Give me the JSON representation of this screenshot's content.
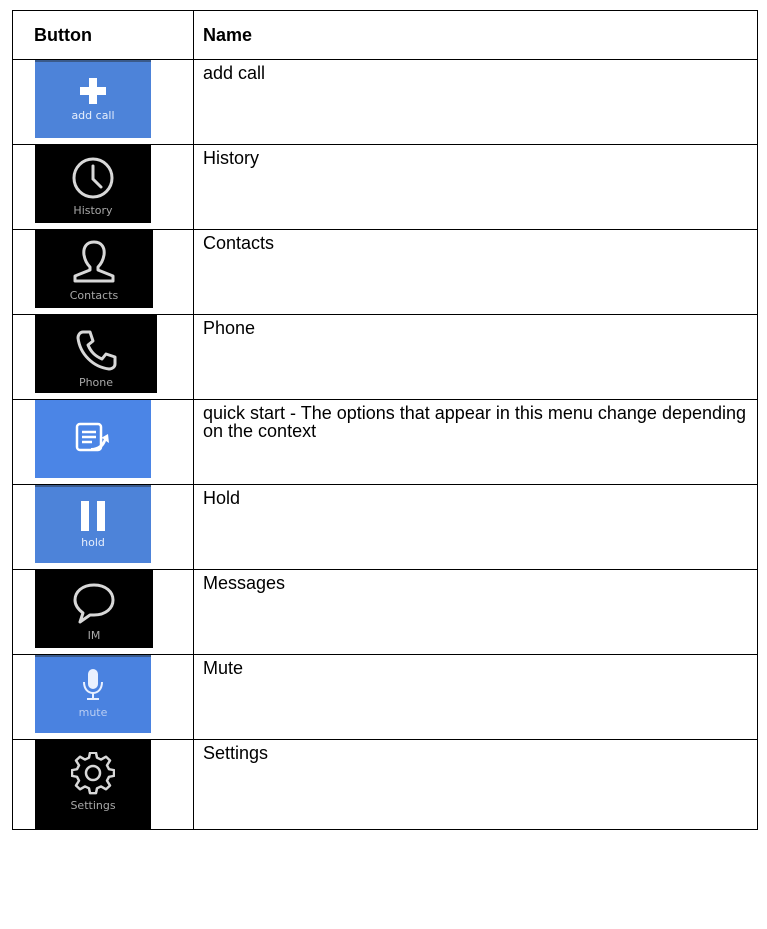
{
  "table": {
    "headers": {
      "button": "Button",
      "name": "Name"
    },
    "rows": [
      {
        "icon": "add-call-icon",
        "caption": "add call",
        "name": "add call",
        "style": "blue"
      },
      {
        "icon": "clock-icon",
        "caption": "History",
        "name": "History",
        "style": "dark"
      },
      {
        "icon": "contact-person-icon",
        "caption": "Contacts",
        "name": "Contacts",
        "style": "dark"
      },
      {
        "icon": "phone-handset-icon",
        "caption": "Phone",
        "name": "Phone",
        "style": "dark"
      },
      {
        "icon": "quick-start-menu-icon",
        "caption": "",
        "name": "quick start   - The options that appear in this menu change depending on the context",
        "style": "blue"
      },
      {
        "icon": "pause-icon",
        "caption": "hold",
        "name": "Hold",
        "style": "blue"
      },
      {
        "icon": "speech-bubble-icon",
        "caption": "IM",
        "name": "Messages",
        "style": "dark"
      },
      {
        "icon": "microphone-icon",
        "caption": "mute",
        "name": "Mute",
        "style": "blue"
      },
      {
        "icon": "gear-icon",
        "caption": "Settings",
        "name": "Settings",
        "style": "dark"
      }
    ]
  },
  "colors": {
    "button_blue": "#4a7fd6",
    "button_dark": "#000000",
    "caption_light": "#e6eefc",
    "caption_gray": "#a8a8a8"
  }
}
